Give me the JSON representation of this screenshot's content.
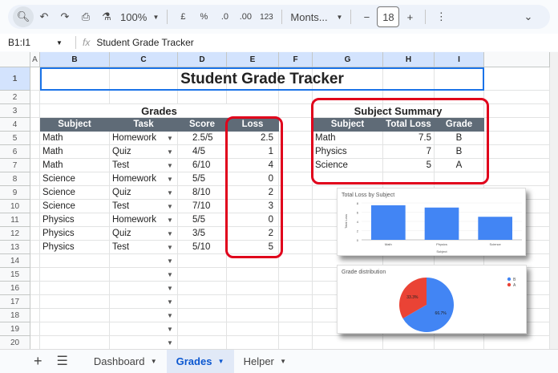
{
  "toolbar": {
    "zoom": "100%",
    "currency": "£",
    "percent": "%",
    "dec_less": ".0",
    "dec_more": ".00",
    "format_123": "123",
    "font": "Monts...",
    "font_size": "18"
  },
  "formula_bar": {
    "name_box": "B1:I1",
    "fx": "fx",
    "content": "Student Grade Tracker"
  },
  "columns": [
    "A",
    "B",
    "C",
    "D",
    "E",
    "F",
    "G",
    "H",
    "I"
  ],
  "title": "Student Grade Tracker",
  "grades": {
    "title": "Grades",
    "headers": [
      "Subject",
      "Task",
      "Score",
      "Loss"
    ],
    "rows": [
      [
        "Math",
        "Homework",
        "2.5/5",
        "2.5"
      ],
      [
        "Math",
        "Quiz",
        "4/5",
        "1"
      ],
      [
        "Math",
        "Test",
        "6/10",
        "4"
      ],
      [
        "Science",
        "Homework",
        "5/5",
        "0"
      ],
      [
        "Science",
        "Quiz",
        "8/10",
        "2"
      ],
      [
        "Science",
        "Test",
        "7/10",
        "3"
      ],
      [
        "Physics",
        "Homework",
        "5/5",
        "0"
      ],
      [
        "Physics",
        "Quiz",
        "3/5",
        "2"
      ],
      [
        "Physics",
        "Test",
        "5/10",
        "5"
      ]
    ]
  },
  "summary": {
    "title": "Subject Summary",
    "headers": [
      "Subject",
      "Total Loss",
      "Grade"
    ],
    "rows": [
      [
        "Math",
        "7.5",
        "B"
      ],
      [
        "Physics",
        "7",
        "B"
      ],
      [
        "Science",
        "5",
        "A"
      ]
    ]
  },
  "chart_data": [
    {
      "type": "bar",
      "title": "Total Loss by Subject",
      "xlabel": "Subject",
      "ylabel": "Total Loss",
      "categories": [
        "Math",
        "Physics",
        "Science"
      ],
      "values": [
        7.5,
        7,
        5
      ],
      "ylim": [
        0,
        8
      ],
      "yticks": [
        "0",
        "2",
        "4",
        "6",
        "8"
      ],
      "color": "#4285f4",
      "grid": true
    },
    {
      "type": "pie",
      "title": "Grade distribution",
      "categories": [
        "B",
        "A"
      ],
      "values": [
        66.7,
        33.3
      ],
      "labels": [
        "66.7%",
        "33.3%"
      ],
      "colors": [
        "#4285f4",
        "#ea4335"
      ],
      "legend": "right"
    }
  ],
  "sheet_tabs": [
    {
      "label": "Dashboard",
      "active": false
    },
    {
      "label": "Grades",
      "active": true
    },
    {
      "label": "Helper",
      "active": false
    }
  ]
}
